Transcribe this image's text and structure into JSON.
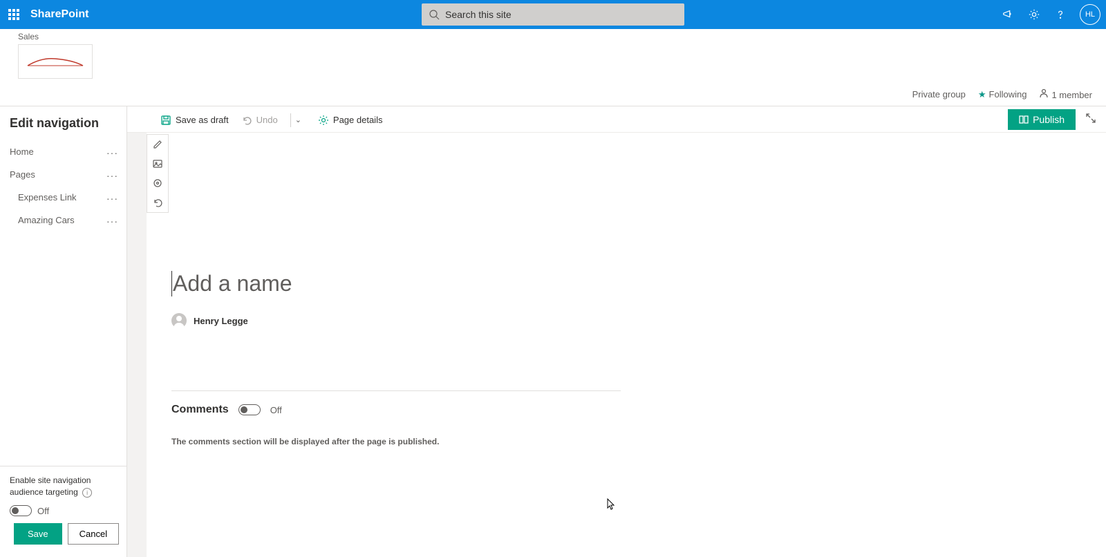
{
  "topbar": {
    "brand": "SharePoint",
    "search_placeholder": "Search this site",
    "avatar_initials": "HL"
  },
  "site": {
    "label": "Sales",
    "privacy": "Private group",
    "following_label": "Following",
    "members_label": "1 member"
  },
  "left_panel": {
    "title": "Edit navigation",
    "items": [
      {
        "label": "Home",
        "sub": false
      },
      {
        "label": "Pages",
        "sub": false
      },
      {
        "label": "Expenses Link",
        "sub": true
      },
      {
        "label": "Amazing Cars",
        "sub": true
      }
    ],
    "audience_label": "Enable site navigation audience targeting",
    "audience_toggle_state": "Off",
    "save_label": "Save",
    "cancel_label": "Cancel"
  },
  "toolbar": {
    "save_draft": "Save as draft",
    "undo": "Undo",
    "page_details": "Page details",
    "publish": "Publish"
  },
  "page": {
    "title_placeholder": "Add a name",
    "author": "Henry Legge"
  },
  "comments": {
    "title": "Comments",
    "toggle_state": "Off",
    "note": "The comments section will be displayed after the page is published."
  },
  "colors": {
    "primary": "#0C87E0",
    "teal": "#03a284"
  }
}
